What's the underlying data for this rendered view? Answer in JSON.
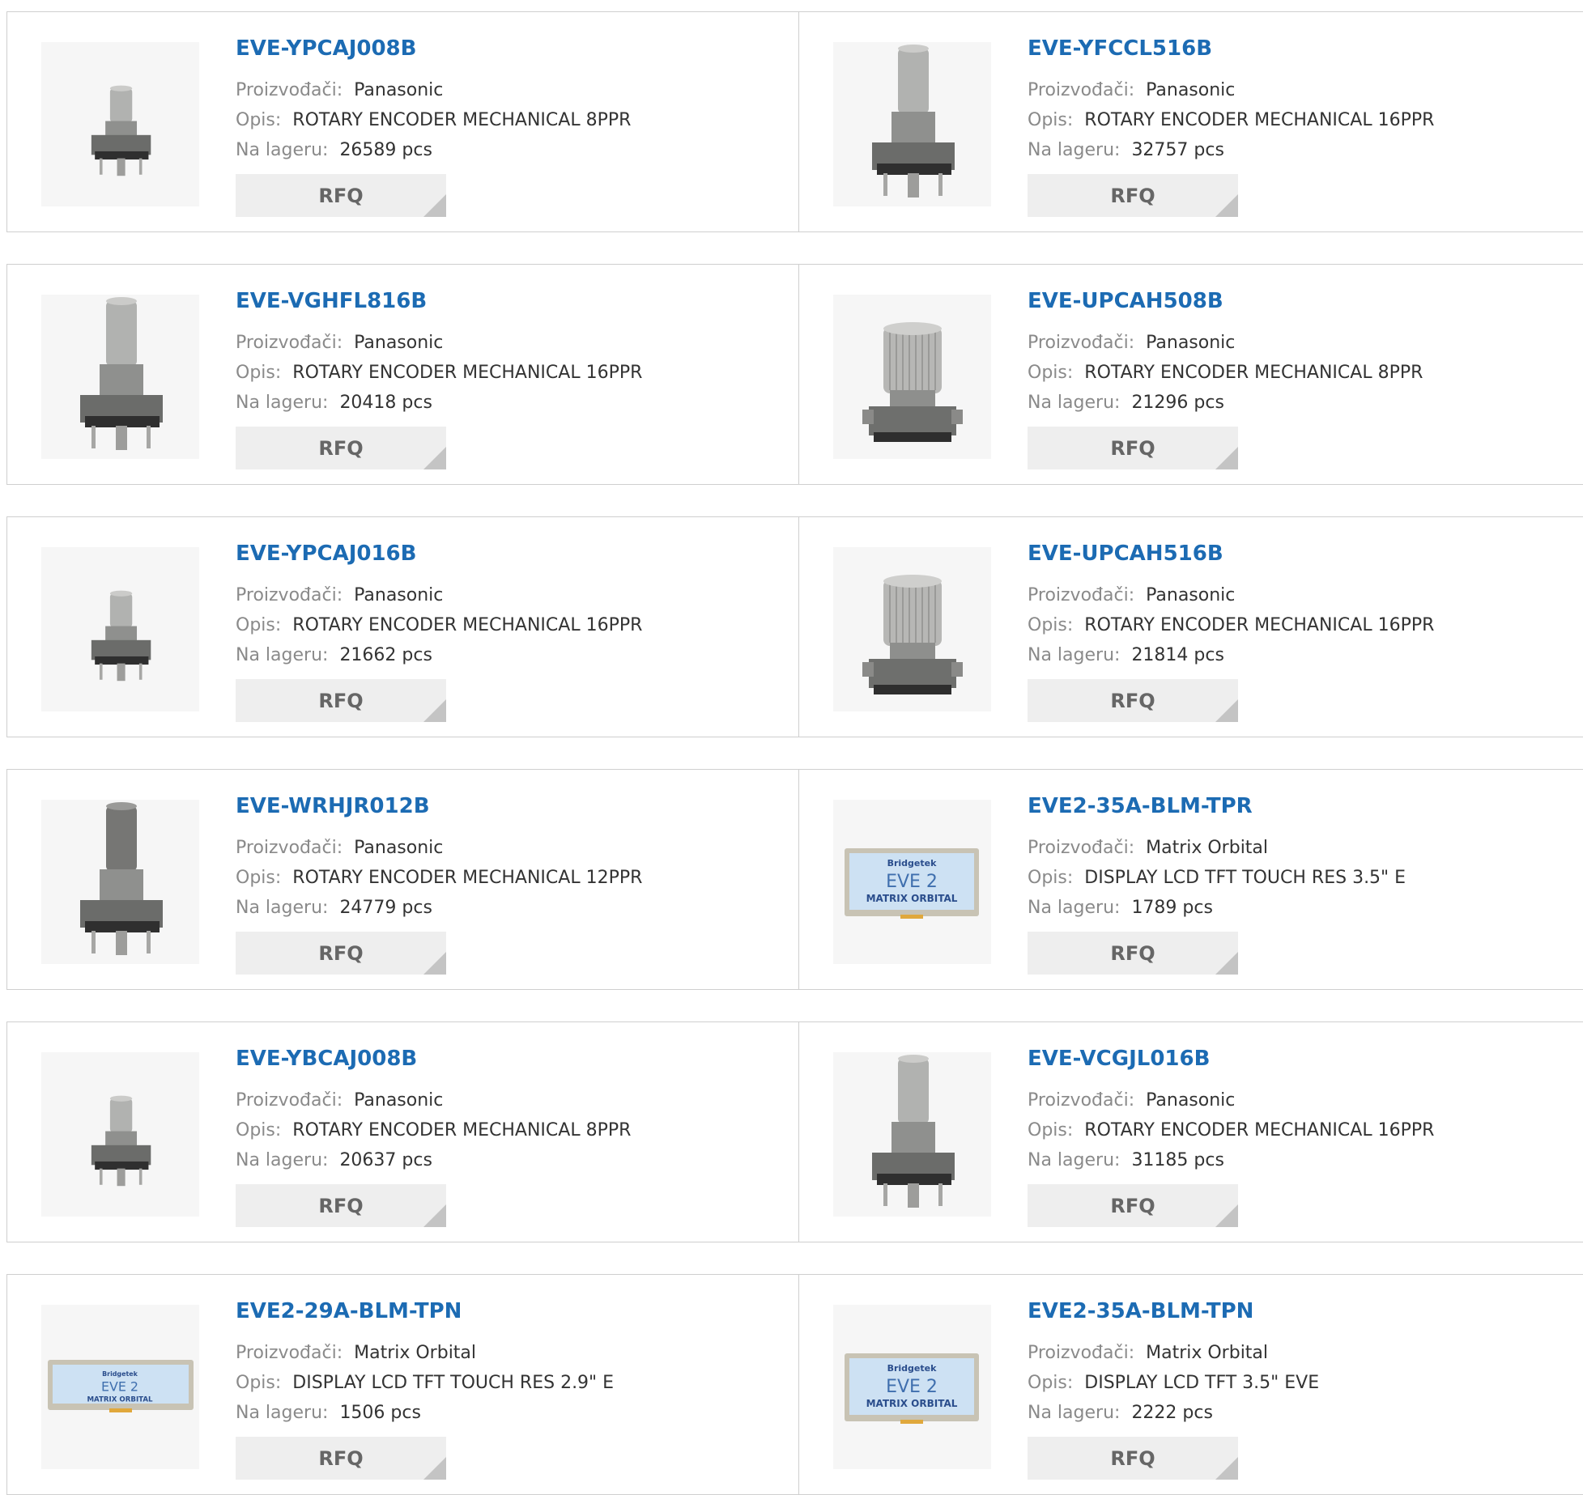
{
  "labels": {
    "manufacturer": "Proizvođači:",
    "description": "Opis:",
    "stock": "Na lageru:",
    "rfq": "RFQ"
  },
  "colors": {
    "title": "#1c6bb3",
    "label": "#8a8a8a",
    "value": "#333333",
    "button_bg": "#eeeeee",
    "border": "#cfcfcf"
  },
  "products": [
    {
      "part": "EVE-YPCAJ008B",
      "manufacturer": "Panasonic",
      "description": "ROTARY ENCODER MECHANICAL 8PPR",
      "stock": "26589 pcs",
      "image": "rotary-encoder-short-image"
    },
    {
      "part": "EVE-YFCCL516B",
      "manufacturer": "Panasonic",
      "description": "ROTARY ENCODER MECHANICAL 16PPR",
      "stock": "32757 pcs",
      "image": "rotary-encoder-tall-image"
    },
    {
      "part": "EVE-VGHFL816B",
      "manufacturer": "Panasonic",
      "description": "ROTARY ENCODER MECHANICAL 16PPR",
      "stock": "20418 pcs",
      "image": "rotary-encoder-tall-image"
    },
    {
      "part": "EVE-UPCAH508B",
      "manufacturer": "Panasonic",
      "description": "ROTARY ENCODER MECHANICAL 8PPR",
      "stock": "21296 pcs",
      "image": "rotary-encoder-knurled-image"
    },
    {
      "part": "EVE-YPCAJ016B",
      "manufacturer": "Panasonic",
      "description": "ROTARY ENCODER MECHANICAL 16PPR",
      "stock": "21662 pcs",
      "image": "rotary-encoder-short-image"
    },
    {
      "part": "EVE-UPCAH516B",
      "manufacturer": "Panasonic",
      "description": "ROTARY ENCODER MECHANICAL 16PPR",
      "stock": "21814 pcs",
      "image": "rotary-encoder-knurled-image"
    },
    {
      "part": "EVE-WRHJR012B",
      "manufacturer": "Panasonic",
      "description": "ROTARY ENCODER MECHANICAL 12PPR",
      "stock": "24779 pcs",
      "image": "rotary-encoder-dark-image"
    },
    {
      "part": "EVE2-35A-BLM-TPR",
      "manufacturer": "Matrix Orbital",
      "description": "DISPLAY LCD TFT TOUCH RES 3.5\" E",
      "stock": "1789 pcs",
      "image": "lcd-display-image"
    },
    {
      "part": "EVE-YBCAJ008B",
      "manufacturer": "Panasonic",
      "description": "ROTARY ENCODER MECHANICAL 8PPR",
      "stock": "20637 pcs",
      "image": "rotary-encoder-short-image"
    },
    {
      "part": "EVE-VCGJL016B",
      "manufacturer": "Panasonic",
      "description": "ROTARY ENCODER MECHANICAL 16PPR",
      "stock": "31185 pcs",
      "image": "rotary-encoder-tall-image"
    },
    {
      "part": "EVE2-29A-BLM-TPN",
      "manufacturer": "Matrix Orbital",
      "description": "DISPLAY LCD TFT TOUCH RES 2.9\" E",
      "stock": "1506 pcs",
      "image": "lcd-display-wide-image"
    },
    {
      "part": "EVE2-35A-BLM-TPN",
      "manufacturer": "Matrix Orbital",
      "description": "DISPLAY LCD TFT 3.5\" EVE",
      "stock": "2222 pcs",
      "image": "lcd-display-image"
    }
  ],
  "display_logo": {
    "brand": "Bridgetek",
    "model": "EVE 2",
    "maker": "MATRIX ORBITAL"
  }
}
